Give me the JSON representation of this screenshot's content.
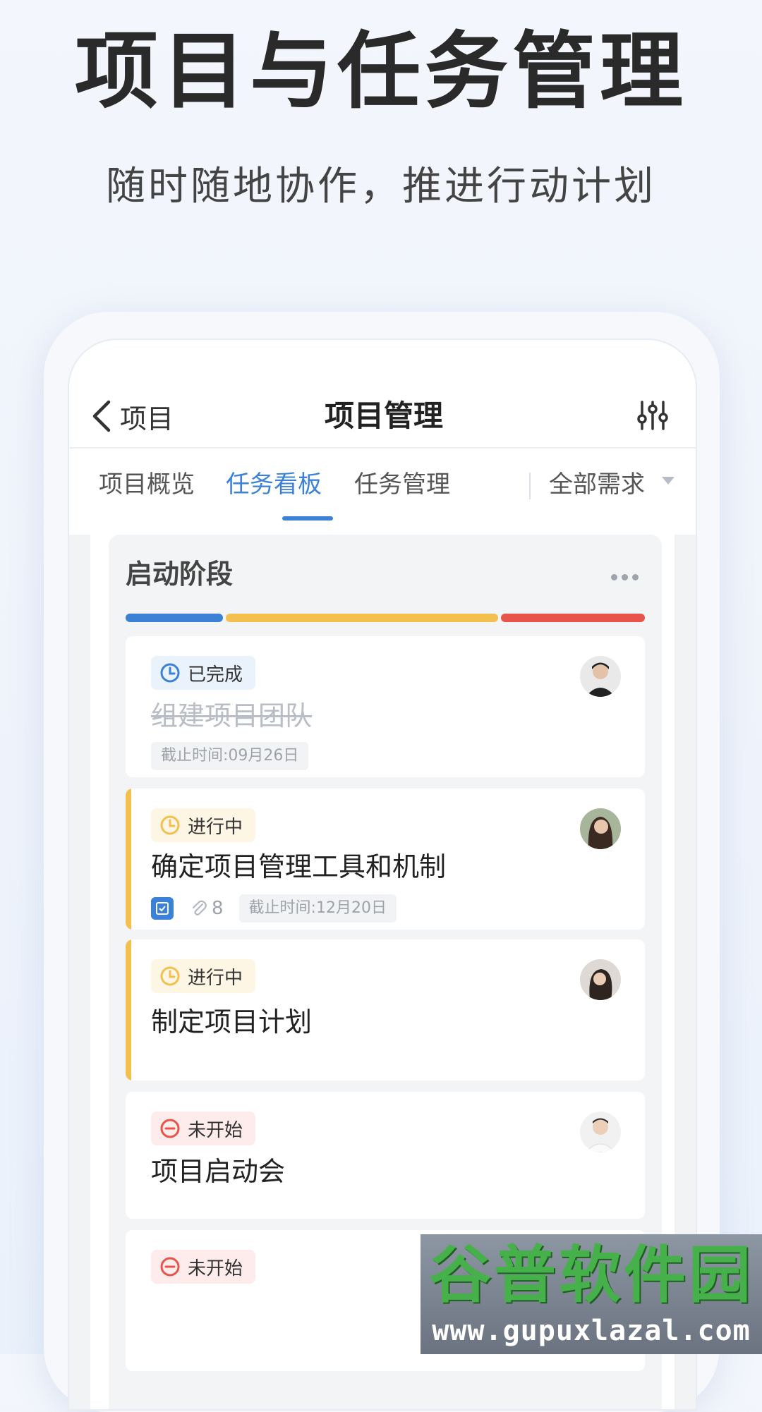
{
  "promo": {
    "headline": "项目与任务管理",
    "subline": "随时随地协作，推进行动计划"
  },
  "navbar": {
    "back_label": "项目",
    "title": "项目管理",
    "filter_icon": "sliders-icon"
  },
  "tabs": [
    {
      "label": "项目概览",
      "active": false
    },
    {
      "label": "任务看板",
      "active": true
    },
    {
      "label": "任务管理",
      "active": false
    },
    {
      "label": "全部需求",
      "active": false,
      "dropdown": true
    }
  ],
  "column": {
    "title": "启动阶段",
    "more_icon": "more-dots-icon",
    "progress_segments": [
      {
        "status": "已完成",
        "color": "#3b82d6",
        "fraction": 0.19
      },
      {
        "status": "进行中",
        "color": "#f3c04f",
        "fraction": 0.53
      },
      {
        "status": "未开始",
        "color": "#e8544c",
        "fraction": 0.28
      }
    ]
  },
  "cards": [
    {
      "status": "已完成",
      "status_color": "#3b82d6",
      "badge_bg": "#eaf2fc",
      "title": "组建项目团队",
      "done": true,
      "deadline": "截止时间:09月26日",
      "accent": null
    },
    {
      "status": "进行中",
      "status_color": "#f3c04f",
      "badge_bg": "#fdf6e5",
      "title": "确定项目管理工具和机制",
      "done": false,
      "attachments": "8",
      "deadline": "截止时间:12月20日",
      "accent": "#f3c04f"
    },
    {
      "status": "进行中",
      "status_color": "#f3c04f",
      "badge_bg": "#fdf6e5",
      "title": "制定项目计划",
      "done": false,
      "accent": "#f3c04f"
    },
    {
      "status": "未开始",
      "status_color": "#e8544c",
      "badge_bg": "#fdeceb",
      "title": "项目启动会",
      "done": false,
      "accent": null
    },
    {
      "status": "未开始",
      "status_color": "#e8544c",
      "badge_bg": "#fdeceb",
      "title": "",
      "done": false,
      "accent": null
    }
  ],
  "watermark": {
    "brand": "谷普软件园",
    "url": "www.gupuxlazal.com"
  }
}
